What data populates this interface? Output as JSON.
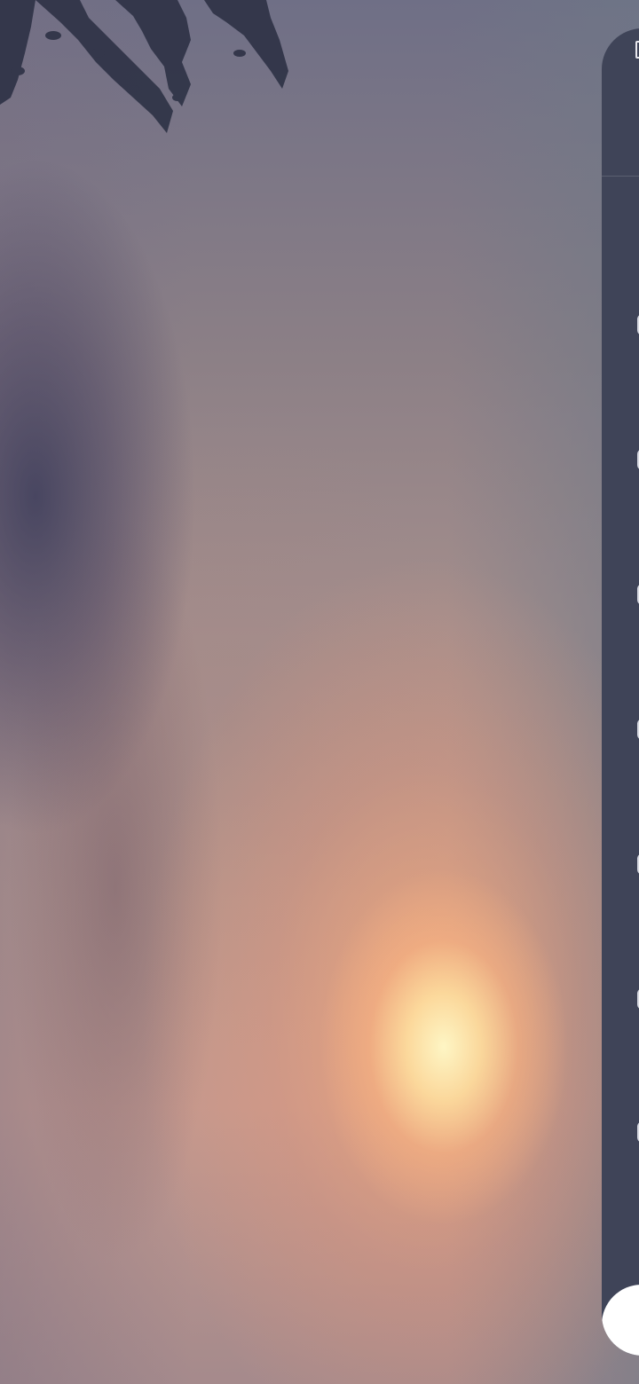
{
  "video": {
    "scene": "sunset-sky"
  },
  "drawer": {
    "background_color": "#3f4458",
    "header_icon": "document-icon",
    "items": [
      {
        "icon": "circle-icon",
        "label": ""
      },
      {
        "icon": "circle-icon",
        "label": ""
      },
      {
        "icon": "circle-icon",
        "label": ""
      },
      {
        "icon": "circle-icon",
        "label": ""
      },
      {
        "icon": "circle-icon",
        "label": ""
      },
      {
        "icon": "circle-icon",
        "label": ""
      },
      {
        "icon": "circle-icon",
        "label": ""
      }
    ],
    "bottom_sheet_color": "#ffffff"
  }
}
